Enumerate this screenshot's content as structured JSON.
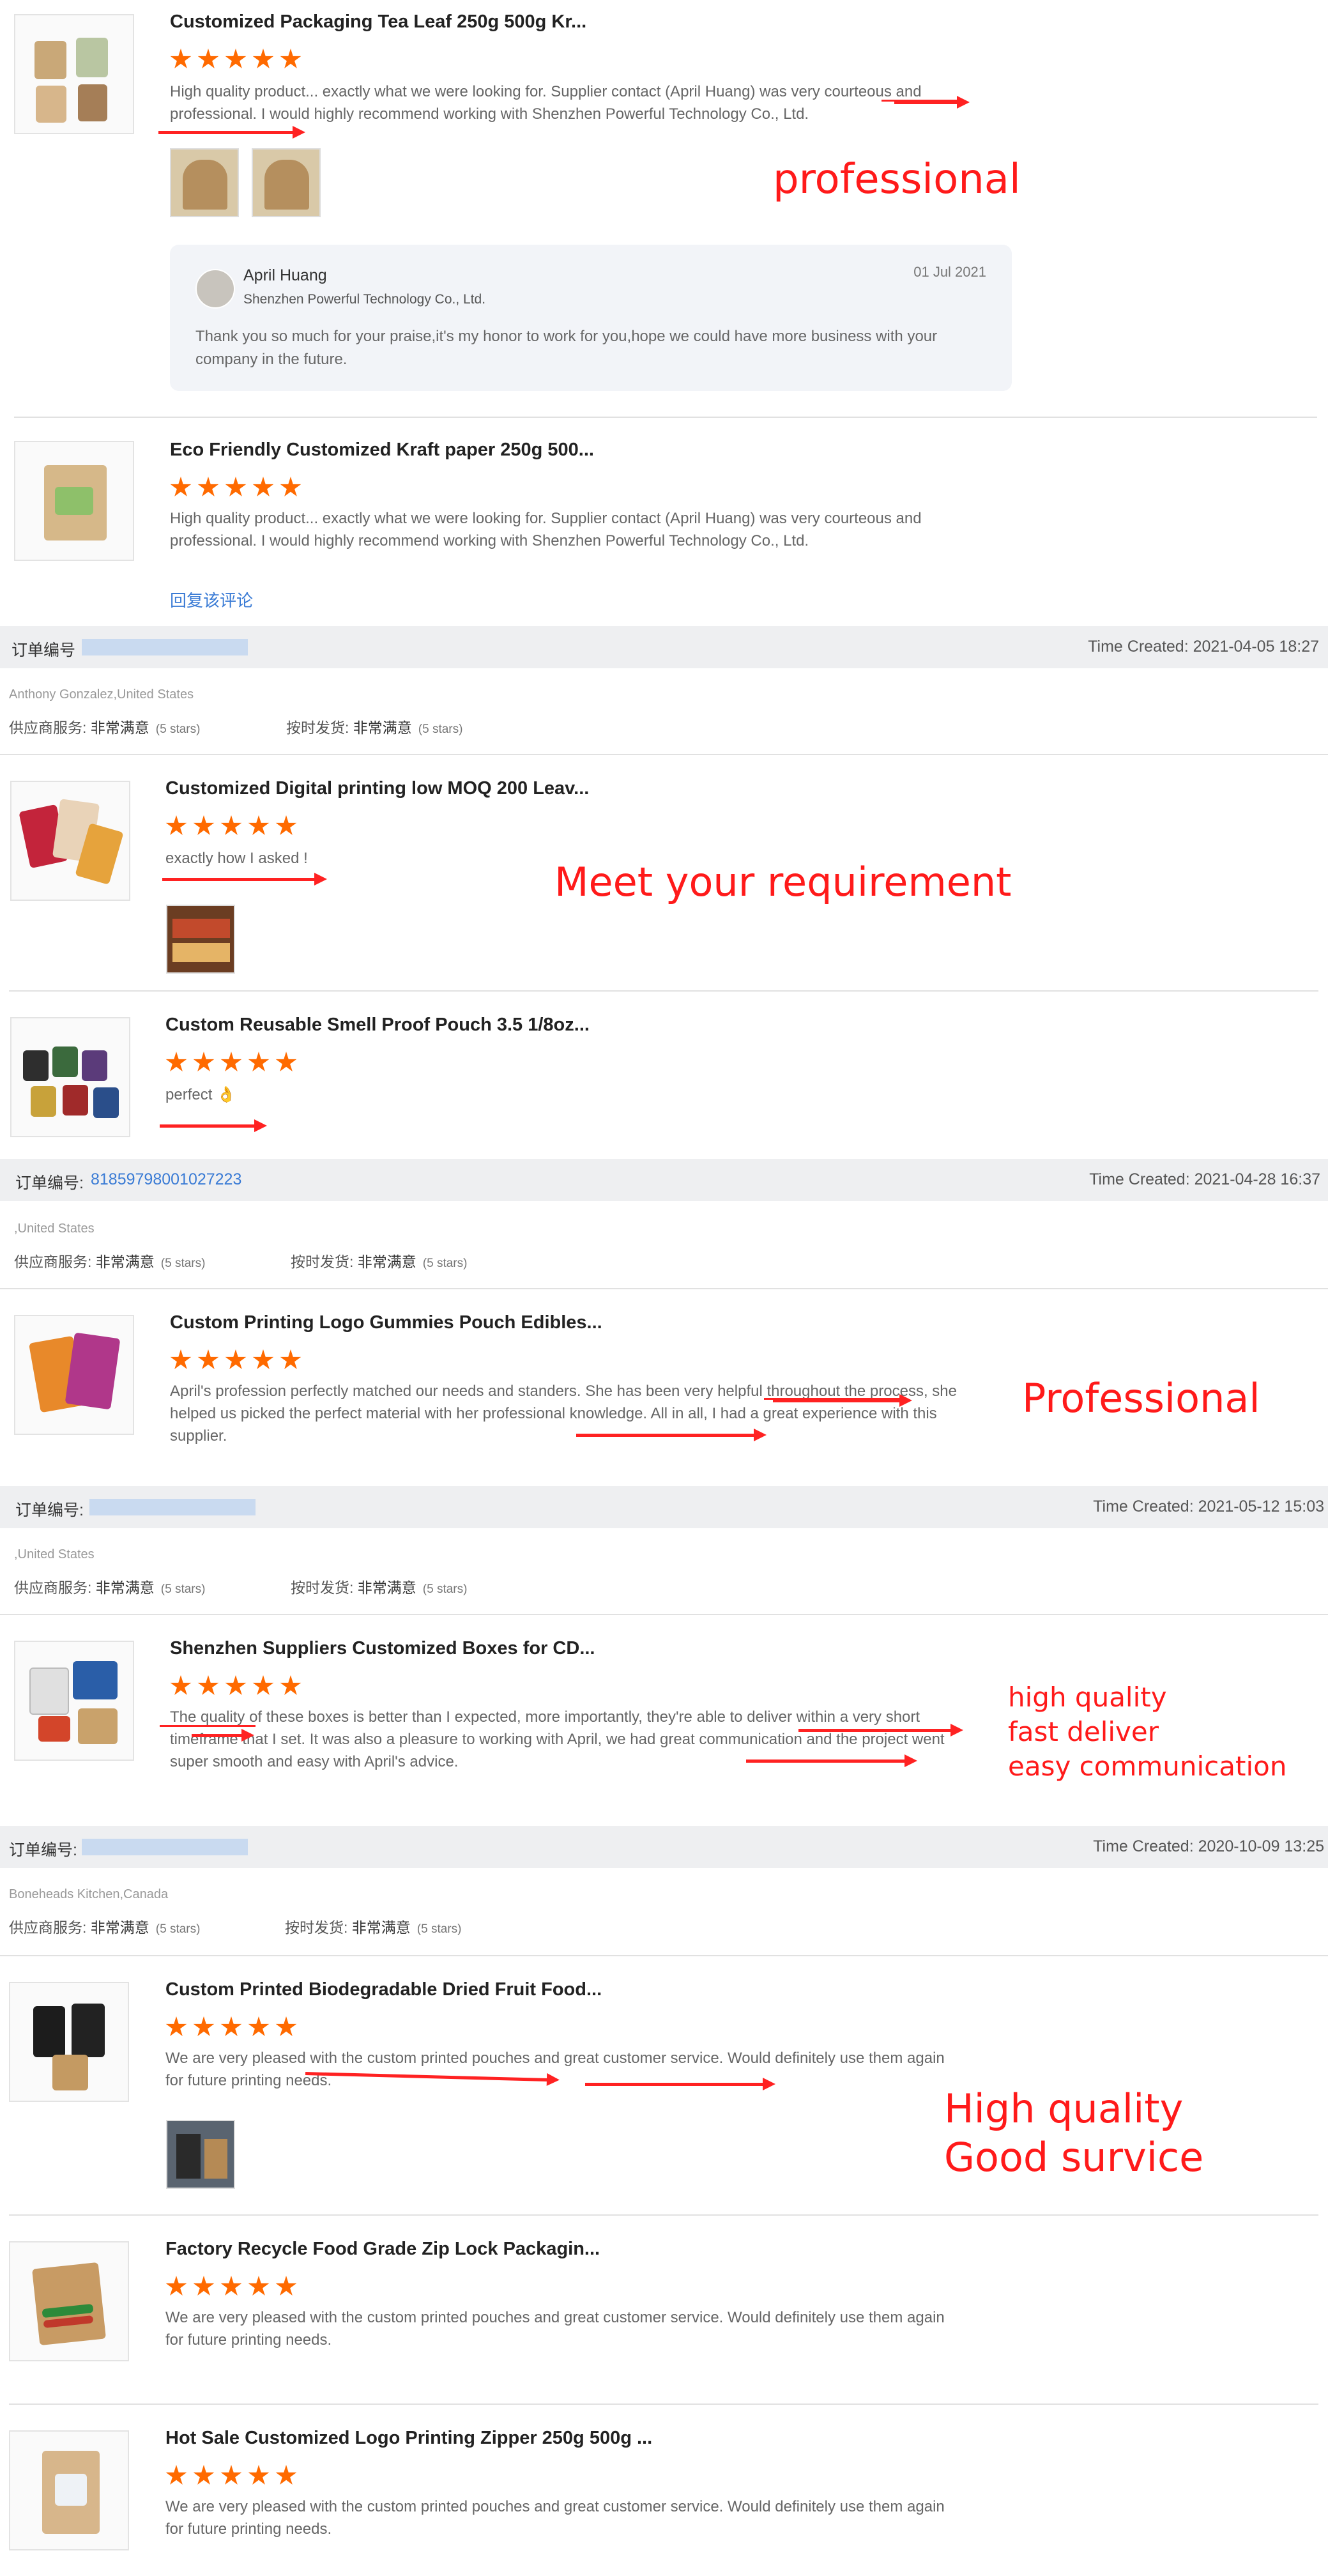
{
  "reviews": [
    {
      "title": "Customized Packaging Tea Leaf 250g 500g Kr...",
      "text": "High quality product... exactly what we were looking for. Supplier contact (April Huang) was very courteous and professional. I would highly recommend working with Shenzhen Powerful Technology Co., Ltd."
    },
    {
      "title": "Eco Friendly Customized Kraft paper 250g 500...",
      "text": "High quality product... exactly what we were looking for. Supplier contact (April Huang) was very courteous and professional. I would highly recommend working with Shenzhen Powerful Technology Co., Ltd."
    },
    {
      "title": "Customized Digital printing low MOQ 200 Leav...",
      "text": "exactly how I asked !"
    },
    {
      "title": "Custom Reusable Smell Proof Pouch 3.5 1/8oz...",
      "text": "perfect 👌"
    },
    {
      "title": "Custom Printing Logo Gummies Pouch Edibles...",
      "text": "April's profession perfectly matched our needs and standers. She has been very helpful throughout the process, she helped us picked the perfect material with her professional knowledge. All in all, I had a great experience with this supplier."
    },
    {
      "title": "Shenzhen Suppliers Customized Boxes for CD...",
      "text": "The quality of these boxes is better than I expected, more importantly, they're able to deliver within a very short timeframe that I set. It was also a pleasure to working with April, we had great communication and the project went super smooth and easy with April's advice."
    },
    {
      "title": "Custom Printed Biodegradable Dried Fruit Food...",
      "text": "We are very pleased with the custom printed pouches and great customer service. Would definitely use them again for future printing needs."
    },
    {
      "title": "Factory Recycle Food Grade Zip Lock Packagin...",
      "text": "We are very pleased with the custom printed pouches and great customer service. Would definitely use them again for future printing needs."
    },
    {
      "title": "Hot Sale Customized Logo Printing Zipper 250g 500g ...",
      "text": "We are very pleased with the custom printed pouches and great customer service. Would definitely use them again for future printing needs."
    }
  ],
  "reply": {
    "name": "April Huang",
    "company": "Shenzhen Powerful Technology Co., Ltd.",
    "date": "01 Jul 2021",
    "text": "Thank you so much for your praise,it's my honor to work for you,hope we could have more  business with your company in the future."
  },
  "reply_link": "回复该评论",
  "orders": [
    {
      "label": "订单编号",
      "number": "",
      "time": "Time Created: 2021-04-05 18:27",
      "buyer": "Anthony Gonzalez,United States"
    },
    {
      "label": "订单编号:",
      "number": "81859798001027223",
      "time": "Time Created: 2021-04-28 16:37",
      "buyer": ",United States"
    },
    {
      "label": "订单编号:",
      "number": "",
      "time": "Time Created: 2021-05-12 15:03",
      "buyer": ",United States"
    },
    {
      "label": "订单编号:",
      "number": "",
      "time": "Time Created: 2020-10-09 13:25",
      "buyer": "Boneheads Kitchen,Canada"
    }
  ],
  "ratings": {
    "service_label": "供应商服务:",
    "ontime_label": "按时发货:",
    "value": "非常满意",
    "stars": "(5 stars)"
  },
  "star_rating": 5,
  "annotations": {
    "a1": "professional",
    "a2": "Meet your requirement",
    "a3": "Professional",
    "a4_1": "high quality",
    "a4_2": "fast deliver",
    "a4_3": "easy communication",
    "a5_1": "High quality",
    "a5_2": "Good survice"
  },
  "colors": {
    "star": "#ff6a00",
    "annotation": "#ff1a1a",
    "link": "#3a7bd5",
    "band": "#eeeff1"
  }
}
